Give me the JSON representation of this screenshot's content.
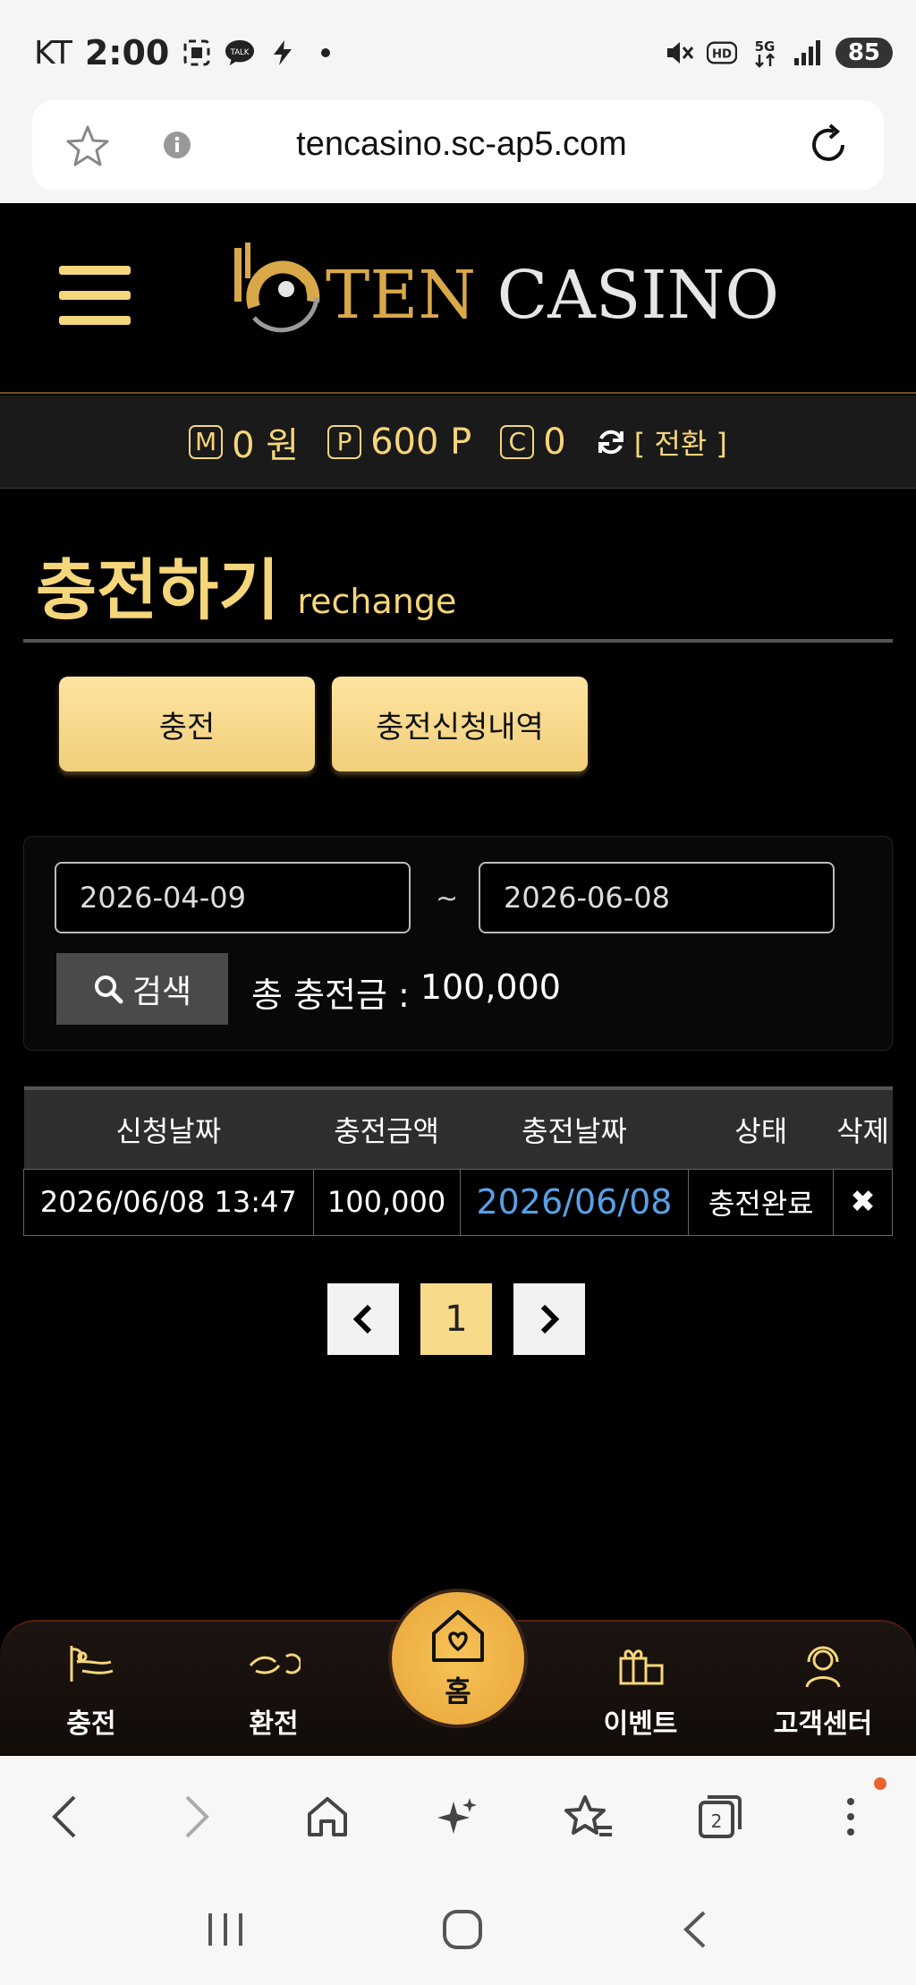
{
  "status_bar": {
    "carrier": "KT",
    "time": "2:00",
    "battery": "85",
    "talk_badge": "TALK",
    "hd_badge": "HD",
    "network": "5G"
  },
  "browser": {
    "url": "tencasino.sc-ap5.com"
  },
  "header": {
    "logo_ten": "TEN",
    "logo_casino": "CASINO"
  },
  "balance": {
    "money_badge": "M",
    "money": "0 원",
    "point_badge": "P",
    "point": "600 P",
    "coin_badge": "C",
    "coin": "0",
    "switch_label": "[ 전환 ]"
  },
  "page": {
    "title_ko": "충전하기",
    "title_en": "rechange"
  },
  "tabs": [
    {
      "label": "충전"
    },
    {
      "label": "충전신청내역"
    }
  ],
  "search": {
    "start_date": "2026-04-09",
    "end_date": "2026-06-08",
    "separator": "~",
    "button_label": "검색",
    "total_label": "총 충전금 :",
    "total_value": "100,000"
  },
  "table": {
    "headers": [
      "신청날짜",
      "충전금액",
      "충전날짜",
      "상태",
      "삭제"
    ],
    "rows": [
      {
        "request_date": "2026/06/08 13:47",
        "amount": "100,000",
        "charge_date": "2026/06/08",
        "status": "충전완료",
        "delete": "✖"
      }
    ]
  },
  "pagination": {
    "prev": "‹",
    "current": "1",
    "next": "›"
  },
  "bottom_nav": [
    {
      "label": "충전"
    },
    {
      "label": "환전"
    },
    {
      "label": "홈"
    },
    {
      "label": "이벤트"
    },
    {
      "label": "고객센터"
    }
  ],
  "browser_nav": {
    "tab_count": "2"
  },
  "colors": {
    "gold": "#f6d67a",
    "link_blue": "#5aa0e6",
    "home_orange": "#e8a53a"
  }
}
